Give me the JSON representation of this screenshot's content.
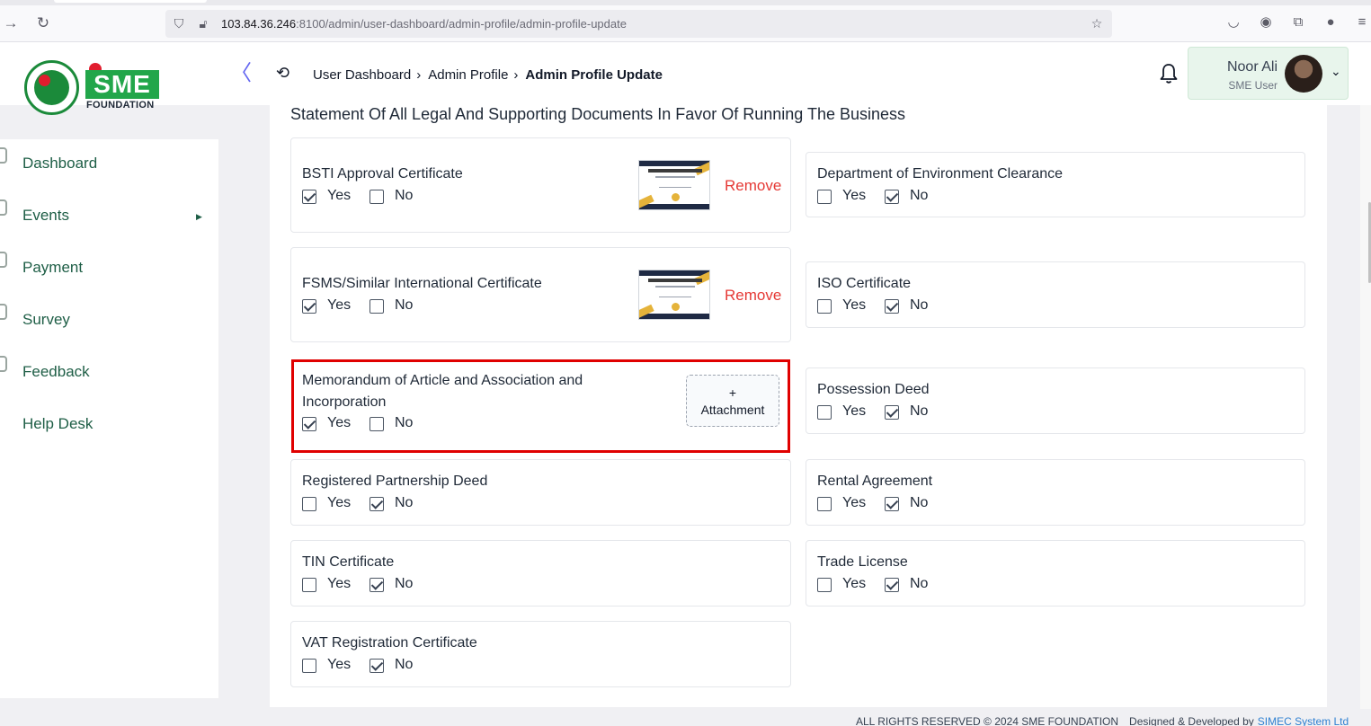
{
  "browser": {
    "url_host": "103.84.36.246",
    "url_rest": ":8100/admin/user-dashboard/admin-profile/admin-profile-update"
  },
  "header": {
    "logo_text": "SME",
    "logo_sub": "FOUNDATION",
    "breadcrumb": [
      "User Dashboard",
      "Admin Profile",
      "Admin Profile Update"
    ],
    "user_name": "Noor Ali",
    "user_role": "SME User"
  },
  "sidebar": {
    "items": [
      {
        "label": "Dashboard",
        "icon": "grid-icon"
      },
      {
        "label": "Events",
        "icon": "calendar-icon"
      },
      {
        "label": "Payment",
        "icon": "payment-icon"
      },
      {
        "label": "Survey",
        "icon": "survey-icon"
      },
      {
        "label": "Feedback",
        "icon": "feedback-icon"
      },
      {
        "label": "Help Desk",
        "icon": "help-icon"
      }
    ]
  },
  "section": {
    "title": "Statement Of All Legal And Supporting Documents In Favor Of Running The Business",
    "yes_label": "Yes",
    "no_label": "No",
    "remove_label": "Remove",
    "attach_plus": "+",
    "attach_label": "Attachment",
    "documents": [
      {
        "title": "BSTI Approval Certificate",
        "yes": true,
        "no": false,
        "attachment": "certificate-thumbnail"
      },
      {
        "title": "Department of Environment Clearance",
        "yes": false,
        "no": true
      },
      {
        "title": "FSMS/Similar International Certificate",
        "yes": true,
        "no": false,
        "attachment": "certificate-thumbnail"
      },
      {
        "title": "ISO Certificate",
        "yes": false,
        "no": true
      },
      {
        "title": "Memorandum of Article and Association and Incorporation",
        "yes": true,
        "no": false,
        "highlighted": true
      },
      {
        "title": "Possession Deed",
        "yes": false,
        "no": true
      },
      {
        "title": "Registered Partnership Deed",
        "yes": false,
        "no": true
      },
      {
        "title": "Rental Agreement",
        "yes": false,
        "no": true
      },
      {
        "title": "TIN Certificate",
        "yes": false,
        "no": true
      },
      {
        "title": "Trade License",
        "yes": false,
        "no": true
      },
      {
        "title": "VAT Registration Certificate",
        "yes": false,
        "no": true
      }
    ]
  },
  "footer": {
    "rights": "ALL RIGHTS RESERVED © 2024 SME FOUNDATION",
    "designed": "Designed & Developed by",
    "company": "SIMEC System Ltd"
  },
  "colors": {
    "accent_green": "#1e5e46",
    "brand_green": "#22a64a",
    "remove_red": "#e53935",
    "highlight_red": "#e00000"
  }
}
